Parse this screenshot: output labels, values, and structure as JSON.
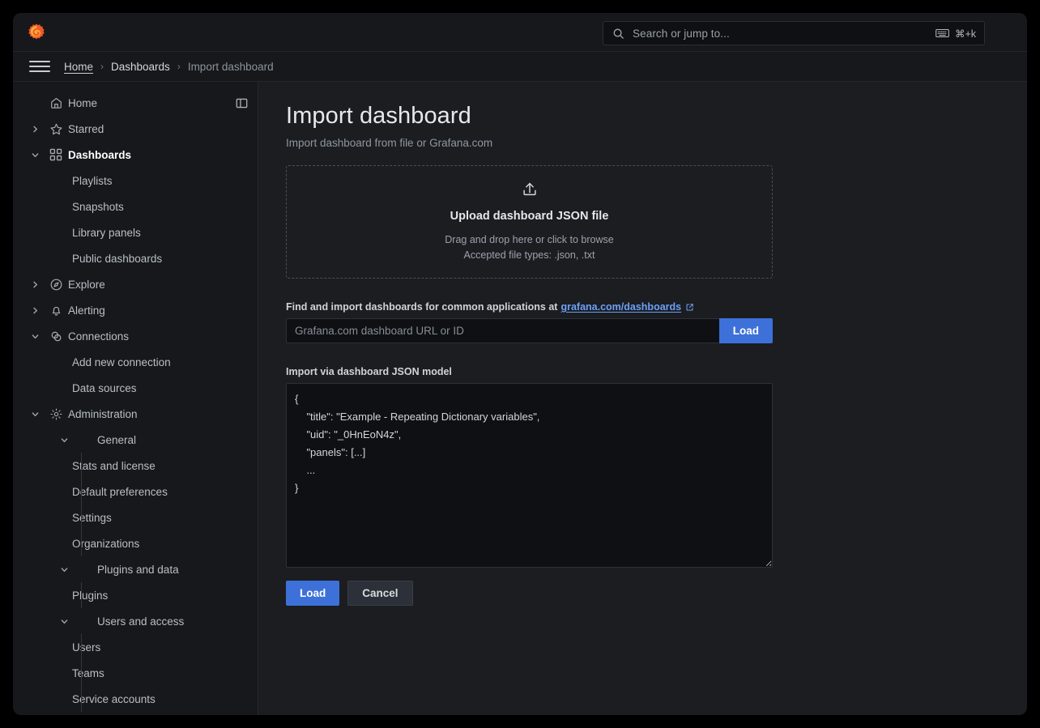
{
  "window": {
    "app": "Grafana",
    "logo_icon": "grafana-logo-icon"
  },
  "topbar": {
    "search": {
      "placeholder": "Search or jump to...",
      "icon": "search-icon",
      "keyboard_icon": "keyboard-icon",
      "shortcut": "⌘+k"
    }
  },
  "breadcrumb": {
    "menu_icon": "hamburger-menu-icon",
    "separator": "›",
    "items": [
      {
        "label": "Home",
        "state": "link-underlined"
      },
      {
        "label": "Dashboards",
        "state": "link"
      },
      {
        "label": "Import dashboard",
        "state": "current"
      }
    ]
  },
  "sidebar": {
    "dock_icon": "dock-menu-icon",
    "items": [
      {
        "label": "Home",
        "icon": "home-icon",
        "level": 0,
        "chevron": "none",
        "active": false,
        "guided": false
      },
      {
        "label": "Starred",
        "icon": "star-icon",
        "level": 0,
        "chevron": "right",
        "active": false,
        "guided": false
      },
      {
        "label": "Dashboards",
        "icon": "grid-icon",
        "level": 0,
        "chevron": "down",
        "active": true,
        "guided": false
      },
      {
        "label": "Playlists",
        "icon": "none",
        "level": 2,
        "chevron": "none",
        "active": false,
        "guided": false
      },
      {
        "label": "Snapshots",
        "icon": "none",
        "level": 2,
        "chevron": "none",
        "active": false,
        "guided": false
      },
      {
        "label": "Library panels",
        "icon": "none",
        "level": 2,
        "chevron": "none",
        "active": false,
        "guided": false
      },
      {
        "label": "Public dashboards",
        "icon": "none",
        "level": 2,
        "chevron": "none",
        "active": false,
        "guided": false
      },
      {
        "label": "Explore",
        "icon": "compass-icon",
        "level": 0,
        "chevron": "right",
        "active": false,
        "guided": false
      },
      {
        "label": "Alerting",
        "icon": "bell-icon",
        "level": 0,
        "chevron": "right",
        "active": false,
        "guided": false
      },
      {
        "label": "Connections",
        "icon": "connections-icon",
        "level": 0,
        "chevron": "down",
        "active": false,
        "guided": false
      },
      {
        "label": "Add new connection",
        "icon": "none",
        "level": 2,
        "chevron": "none",
        "active": false,
        "guided": false
      },
      {
        "label": "Data sources",
        "icon": "none",
        "level": 2,
        "chevron": "none",
        "active": false,
        "guided": false
      },
      {
        "label": "Administration",
        "icon": "gear-icon",
        "level": 0,
        "chevron": "down",
        "active": false,
        "guided": false
      },
      {
        "label": "General",
        "icon": "none",
        "level": 1,
        "chevron": "down-sub",
        "active": false,
        "guided": false
      },
      {
        "label": "Stats and license",
        "icon": "none",
        "level": 3,
        "chevron": "none",
        "active": false,
        "guided": true
      },
      {
        "label": "Default preferences",
        "icon": "none",
        "level": 3,
        "chevron": "none",
        "active": false,
        "guided": true
      },
      {
        "label": "Settings",
        "icon": "none",
        "level": 3,
        "chevron": "none",
        "active": false,
        "guided": true
      },
      {
        "label": "Organizations",
        "icon": "none",
        "level": 3,
        "chevron": "none",
        "active": false,
        "guided": true
      },
      {
        "label": "Plugins and data",
        "icon": "none",
        "level": 1,
        "chevron": "down-sub",
        "active": false,
        "guided": false
      },
      {
        "label": "Plugins",
        "icon": "none",
        "level": 3,
        "chevron": "none",
        "active": false,
        "guided": true
      },
      {
        "label": "Users and access",
        "icon": "none",
        "level": 1,
        "chevron": "down-sub",
        "active": false,
        "guided": false
      },
      {
        "label": "Users",
        "icon": "none",
        "level": 3,
        "chevron": "none",
        "active": false,
        "guided": true
      },
      {
        "label": "Teams",
        "icon": "none",
        "level": 3,
        "chevron": "none",
        "active": false,
        "guided": true
      },
      {
        "label": "Service accounts",
        "icon": "none",
        "level": 3,
        "chevron": "none",
        "active": false,
        "guided": true
      }
    ]
  },
  "main": {
    "title": "Import dashboard",
    "subtitle": "Import dashboard from file or Grafana.com",
    "dropzone": {
      "icon": "upload-icon",
      "title": "Upload dashboard JSON file",
      "line1": "Drag and drop here or click to browse",
      "line2": "Accepted file types: .json, .txt"
    },
    "url_section": {
      "label_prefix": "Find and import dashboards for common applications at",
      "link_text": "grafana.com/dashboards",
      "external_icon": "external-link-icon",
      "input_placeholder": "Grafana.com dashboard URL or ID",
      "input_value": "",
      "load_label": "Load"
    },
    "json_section": {
      "label": "Import via dashboard JSON model",
      "value": "{\n    \"title\": \"Example - Repeating Dictionary variables\",\n    \"uid\": \"_0HnEoN4z\",\n    \"panels\": [...]\n    ...\n}"
    },
    "actions": {
      "load_label": "Load",
      "cancel_label": "Cancel"
    }
  },
  "colors": {
    "accent_blue": "#3d71d9",
    "link_blue": "#6ca0f7",
    "page_bg": "#1b1d21",
    "chrome_bg": "#16181b",
    "input_bg": "#0e1013",
    "logo_orange": "#f05a28",
    "logo_yellow": "#fbb03b"
  }
}
